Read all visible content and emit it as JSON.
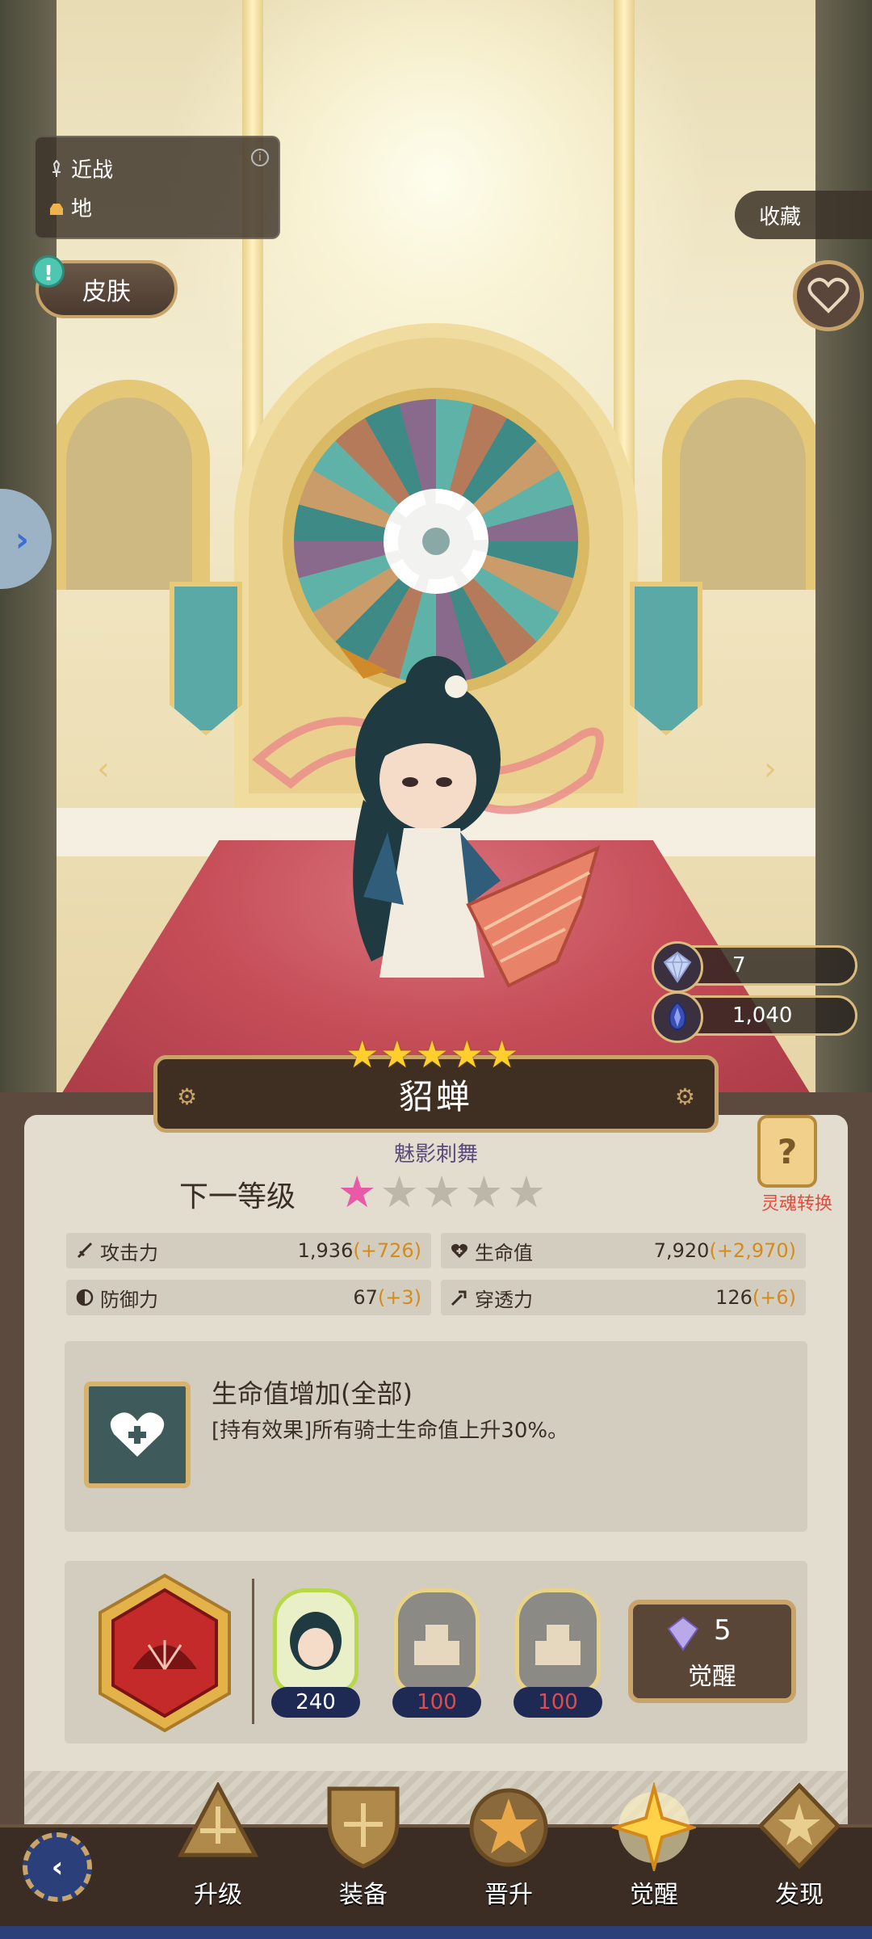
{
  "character": {
    "class_label": "近战",
    "terrain_label": "地",
    "name": "貂蝉",
    "title": "魅影刺舞",
    "star_count": 5
  },
  "top": {
    "skin_button": "皮肤",
    "collect_button": "收藏"
  },
  "resources": [
    {
      "name": "awaken-crystal",
      "value": "7"
    },
    {
      "name": "soul-crystal",
      "value": "1,040"
    }
  ],
  "level": {
    "next_level_label": "下一等级",
    "next_stars_filled": 1,
    "next_stars_total": 5
  },
  "soul_swap_label": "灵魂转换",
  "stats": [
    {
      "label": "攻击力",
      "value": "1,936",
      "delta": "(+726)"
    },
    {
      "label": "生命值",
      "value": "7,920",
      "delta": "(+2,970)"
    },
    {
      "label": "防御力",
      "value": "67",
      "delta": "(+3)"
    },
    {
      "label": "穿透力",
      "value": "126",
      "delta": "(+6)"
    }
  ],
  "effect": {
    "title": "生命值增加(全部)",
    "description": "[持有效果]所有骑士生命值上升30%。"
  },
  "awaken": {
    "materials": [
      {
        "count": "240",
        "type": "hero-shard"
      },
      {
        "count": "100",
        "type": "gray-stone"
      },
      {
        "count": "100",
        "type": "gray-stone"
      }
    ],
    "cost": "5",
    "button_label": "觉醒"
  },
  "bottom_nav": [
    {
      "label": "升级",
      "active": false
    },
    {
      "label": "装备",
      "active": false
    },
    {
      "label": "晋升",
      "active": false
    },
    {
      "label": "觉醒",
      "active": true
    },
    {
      "label": "发现",
      "active": false
    }
  ],
  "colors": {
    "panel": "#e3ddd0",
    "stat_delta": "#d68a1a",
    "gold_border": "#c9a46a",
    "active_star": "#e85aa8"
  }
}
